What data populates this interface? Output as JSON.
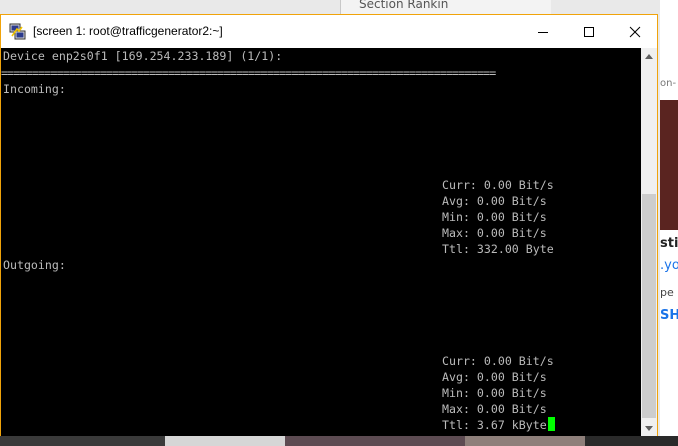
{
  "window": {
    "title": "[screen 1: root@trafficgenerator2:~]"
  },
  "terminal": {
    "header": "Device enp2s0f1 [169.254.233.189] (1/1):",
    "separator": "================================================================================",
    "incoming": {
      "label": "Incoming:",
      "curr": "Curr: 0.00 Bit/s",
      "avg": "Avg: 0.00 Bit/s",
      "min": "Min: 0.00 Bit/s",
      "max": "Max: 0.00 Bit/s",
      "ttl": "Ttl: 332.00 Byte"
    },
    "outgoing": {
      "label": "Outgoing:",
      "curr": "Curr: 0.00 Bit/s",
      "avg": "Avg: 0.00 Bit/s",
      "min": "Min: 0.00 Bit/s",
      "max": "Max: 0.00 Bit/s",
      "ttl": "Ttl: 3.67 kByte"
    }
  },
  "background": {
    "top_window_title": "Section Rankin",
    "right_text_1": "on-",
    "right_text_2": "sti",
    "right_text_3": ".yo",
    "right_text_4": "pe",
    "right_text_5": "SH"
  },
  "colors": {
    "window_border": "#f0a30a",
    "terminal_bg": "#000000",
    "terminal_fg": "#bbbbbb",
    "cursor": "#00ff00"
  },
  "icons": {
    "app": "putty-icon",
    "minimize": "minimize-icon",
    "maximize": "maximize-icon",
    "close": "close-icon"
  }
}
